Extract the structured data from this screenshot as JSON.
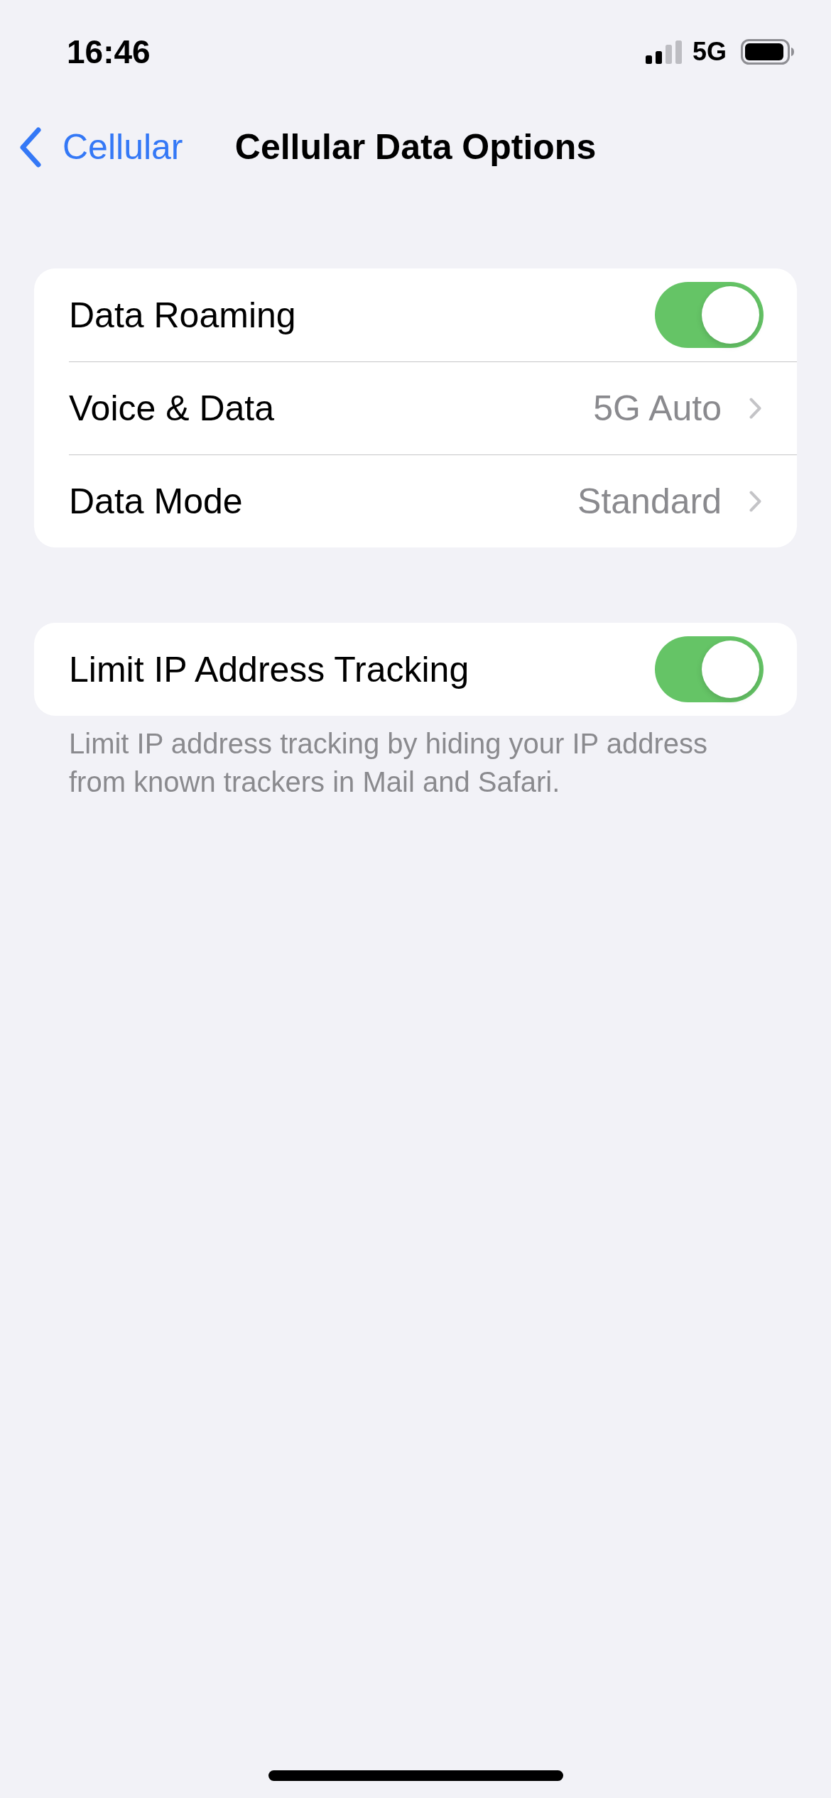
{
  "status_bar": {
    "time": "16:46",
    "network": "5G"
  },
  "nav_bar": {
    "back_label": "Cellular",
    "title": "Cellular Data Options"
  },
  "groups": [
    {
      "rows": [
        {
          "kind": "toggle",
          "label": "Data Roaming",
          "on": true
        },
        {
          "kind": "link",
          "label": "Voice & Data",
          "value": "5G Auto"
        },
        {
          "kind": "link",
          "label": "Data Mode",
          "value": "Standard"
        }
      ]
    },
    {
      "rows": [
        {
          "kind": "toggle",
          "label": "Limit IP Address Tracking",
          "on": true
        }
      ],
      "footer": "Limit IP address tracking by hiding your IP address from known trackers in Mail and Safari."
    }
  ]
}
